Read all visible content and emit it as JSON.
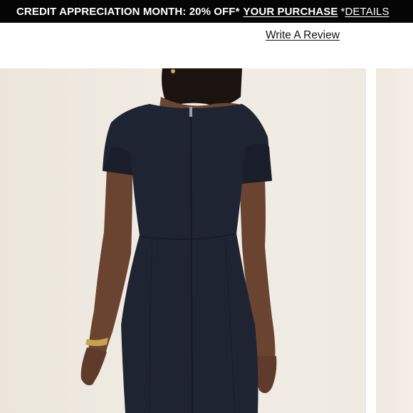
{
  "promo_banner": {
    "text": "CREDIT APPRECIATION MONTH: 20% OFF*",
    "link_text": "YOUR PURCHASE",
    "asterisk": "*",
    "details_link": "DETAILS"
  },
  "product": {
    "review_link": "Write A Review",
    "main_image": "navy short-sleeve sheath dress, back view",
    "next_image": "partially visible next product image"
  },
  "colors": {
    "banner_background": "#050505",
    "banner_text": "#ffffff",
    "dress_navy": "#1f2433",
    "image_background": "#eee9e0"
  }
}
